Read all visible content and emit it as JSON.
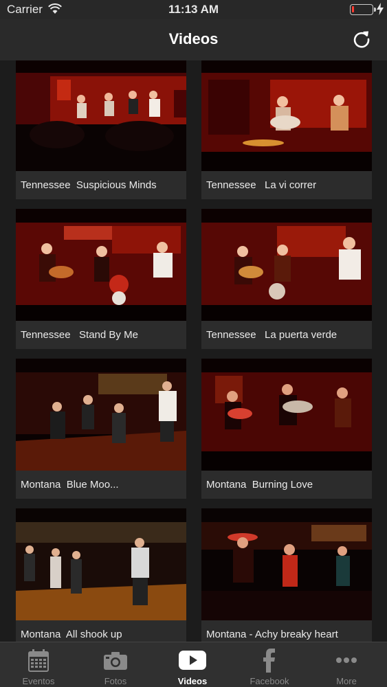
{
  "status_bar": {
    "carrier": "Carrier",
    "time": "11:13 AM",
    "battery_level": 0.12
  },
  "nav": {
    "title": "Videos"
  },
  "videos": [
    {
      "title": "Tennessee  Suspicious Minds"
    },
    {
      "title": "Tennessee   La vi correr"
    },
    {
      "title": "Tennessee   Stand By Me"
    },
    {
      "title": "Tennessee   La puerta verde"
    },
    {
      "title": "Montana  Blue Moo..."
    },
    {
      "title": "Montana  Burning Love"
    },
    {
      "title": "Montana  All shook up"
    },
    {
      "title": "Montana - Achy breaky heart"
    }
  ],
  "tabs": [
    {
      "label": "Eventos",
      "icon": "calendar-icon",
      "active": false
    },
    {
      "label": "Fotos",
      "icon": "camera-icon",
      "active": false
    },
    {
      "label": "Videos",
      "icon": "play-icon",
      "active": true
    },
    {
      "label": "Facebook",
      "icon": "facebook-icon",
      "active": false
    },
    {
      "label": "More",
      "icon": "more-icon",
      "active": false
    }
  ],
  "colors": {
    "accent": "#ffffff",
    "tab_inactive": "#8a8a8a",
    "battery_low": "#ff3b30"
  }
}
